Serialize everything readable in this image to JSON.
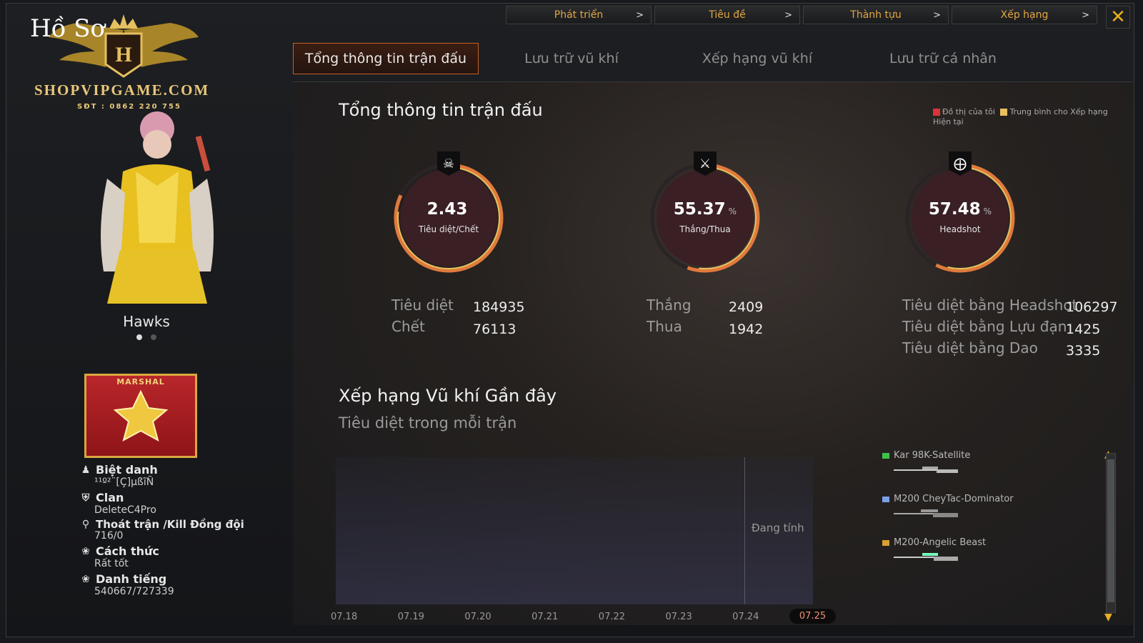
{
  "brand": {
    "title": "Hồ Sơ",
    "site": "SHOPVIPGAME.COM",
    "phone": "SĐT : 0862 220 755"
  },
  "top_menu": [
    {
      "label": "Phát triển"
    },
    {
      "label": "Tiêu đề"
    },
    {
      "label": "Thành tựu"
    },
    {
      "label": "Xếp hạng"
    }
  ],
  "tabs": [
    {
      "label": "Tổng thông tin trận đấu",
      "active": true
    },
    {
      "label": "Lưu trữ vũ khí"
    },
    {
      "label": "Xếp hạng vũ khí"
    },
    {
      "label": "Lưu trữ cá nhân"
    }
  ],
  "character": {
    "name": "Hawks"
  },
  "rank": {
    "label": "MARSHAL"
  },
  "profile": {
    "nickname_label": "Biệt danh",
    "nickname_value": "¹¹º²¨[Ç]µßĩÑ",
    "clan_label": "Clan",
    "clan_value": "DeleteC4Pro",
    "quit_label": "Thoát trận /Kill Đồng đội",
    "quit_value": "716/0",
    "manner_label": "Cách thức",
    "manner_value": "Rất tốt",
    "fame_label": "Danh tiếng",
    "fame_value": "540667/727339"
  },
  "summary": {
    "title": "Tổng thông tin trận đấu",
    "legend_mine": "Đồ thị của tôi",
    "legend_avg": "Trung bình cho Xếp hạng Hiện tại",
    "colors": {
      "mine": "#d8343a",
      "avg": "#e8c060"
    }
  },
  "gauges": [
    {
      "value": "2.43",
      "unit": "",
      "label": "Tiêu diệt/Chết",
      "icon": "skull-icon",
      "fill": 0.82
    },
    {
      "value": "55.37",
      "unit": "%",
      "label": "Thắng/Thua",
      "icon": "crossed-swords-icon",
      "fill": 0.5537
    },
    {
      "value": "57.48",
      "unit": "%",
      "label": "Headshot",
      "icon": "headshot-icon",
      "fill": 0.5748
    }
  ],
  "stats": {
    "kills_label": "Tiêu diệt",
    "kills_value": "184935",
    "deaths_label": "Chết",
    "deaths_value": "76113",
    "wins_label": "Thắng",
    "wins_value": "2409",
    "losses_label": "Thua",
    "losses_value": "1942",
    "hs_label": "Tiêu diệt bằng Headshot",
    "hs_value": "106297",
    "grenade_label": "Tiêu diệt bằng Lựu đạn",
    "grenade_value": "1425",
    "knife_label": "Tiêu diệt bằng Dao",
    "knife_value": "3335"
  },
  "weapon_rank": {
    "title": "Xếp hạng Vũ khí Gần đây",
    "subtitle": "Tiêu diệt trong mỗi trận",
    "calculating": "Đang tính",
    "dates": [
      "07.18",
      "07.19",
      "07.20",
      "07.21",
      "07.22",
      "07.23",
      "07.24",
      "07.25"
    ],
    "active_date": "07.25",
    "weapons": [
      {
        "name": "Kar 98K-Satellite",
        "color": "#3cc24a"
      },
      {
        "name": "M200 CheyTac-Dominator",
        "color": "#7aa0e8"
      },
      {
        "name": "M200-Angelic Beast",
        "color": "#d9a030"
      }
    ]
  },
  "chart_data": {
    "type": "line",
    "categories": [
      "07.18",
      "07.19",
      "07.20",
      "07.21",
      "07.22",
      "07.23",
      "07.24",
      "07.25"
    ],
    "series": [],
    "title": "Xếp hạng Vũ khí Gần đây",
    "subtitle": "Tiêu diệt trong mỗi trận"
  }
}
